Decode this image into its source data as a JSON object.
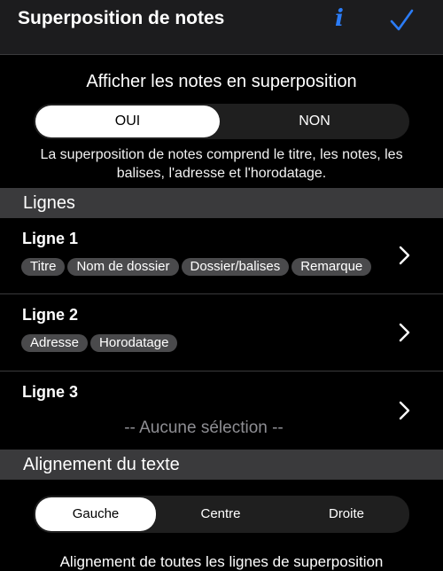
{
  "header": {
    "title": "Superposition de notes",
    "info_icon": "info-icon",
    "confirm_icon": "checkmark-icon",
    "accent_color": "#2b7cf6"
  },
  "overlay": {
    "title": "Afficher les notes en superposition",
    "toggle": {
      "options": [
        "OUI",
        "NON"
      ],
      "selected": "OUI"
    },
    "description": "La superposition de notes comprend le titre, les notes, les balises, l'adresse et l'horodatage."
  },
  "lines_section": {
    "title": "Lignes",
    "rows": [
      {
        "label": "Ligne 1",
        "tags": [
          "Titre",
          "Nom de dossier",
          "Dossier/balises",
          "Remarque"
        ]
      },
      {
        "label": "Ligne 2",
        "tags": [
          "Adresse",
          "Horodatage"
        ]
      },
      {
        "label": "Ligne 3",
        "tags": [],
        "empty_text": "-- Aucune sélection --"
      }
    ]
  },
  "alignment": {
    "title": "Alignement du texte",
    "options": [
      "Gauche",
      "Centre",
      "Droite"
    ],
    "selected": "Gauche",
    "description": "Alignement de toutes les lignes de superposition"
  }
}
